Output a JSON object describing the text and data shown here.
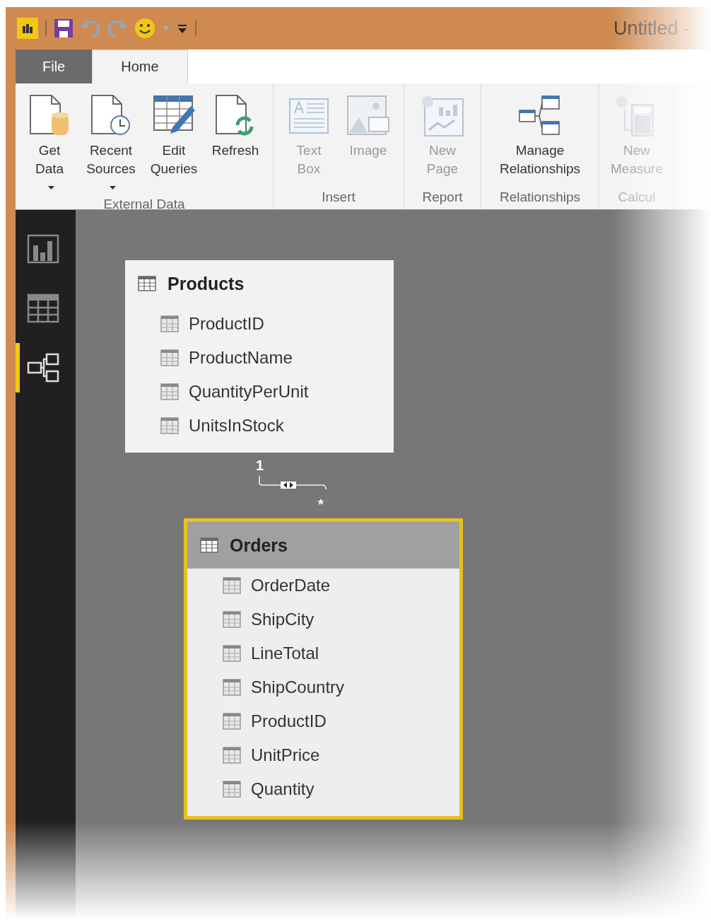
{
  "window": {
    "title": "Untitled -"
  },
  "tabs": [
    {
      "label": "File",
      "selected": false,
      "kind": "file"
    },
    {
      "label": "Home",
      "selected": true,
      "kind": "tab"
    }
  ],
  "ribbon": {
    "groups": [
      {
        "label": "External Data",
        "buttons": [
          {
            "label": "Get Data",
            "dropdown": true,
            "disabled": false
          },
          {
            "label": "Recent Sources",
            "dropdown": true,
            "disabled": false
          },
          {
            "label": "Edit Queries",
            "dropdown": false,
            "disabled": false
          },
          {
            "label": "Refresh",
            "dropdown": false,
            "disabled": false
          }
        ]
      },
      {
        "label": "Insert",
        "buttons": [
          {
            "label": "Text Box",
            "dropdown": false,
            "disabled": true
          },
          {
            "label": "Image",
            "dropdown": false,
            "disabled": true
          }
        ]
      },
      {
        "label": "Report",
        "buttons": [
          {
            "label": "New Page",
            "dropdown": false,
            "disabled": true
          }
        ]
      },
      {
        "label": "Relationships",
        "buttons": [
          {
            "label": "Manage Relationships",
            "dropdown": false,
            "disabled": false
          }
        ]
      },
      {
        "label": "Calcul",
        "buttons": [
          {
            "label": "New Measure",
            "dropdown": false,
            "disabled": true
          }
        ]
      }
    ]
  },
  "sidebar": {
    "items": [
      {
        "selected": false
      },
      {
        "selected": false
      },
      {
        "selected": true
      }
    ]
  },
  "tables": [
    {
      "name": "Products",
      "selected": false,
      "fields": [
        "ProductID",
        "ProductName",
        "QuantityPerUnit",
        "UnitsInStock"
      ]
    },
    {
      "name": "Orders",
      "selected": true,
      "fields": [
        "OrderDate",
        "ShipCity",
        "LineTotal",
        "ShipCountry",
        "ProductID",
        "UnitPrice",
        "Quantity"
      ]
    }
  ],
  "relationship": {
    "from_cardinality": "1",
    "to_cardinality": "*"
  }
}
